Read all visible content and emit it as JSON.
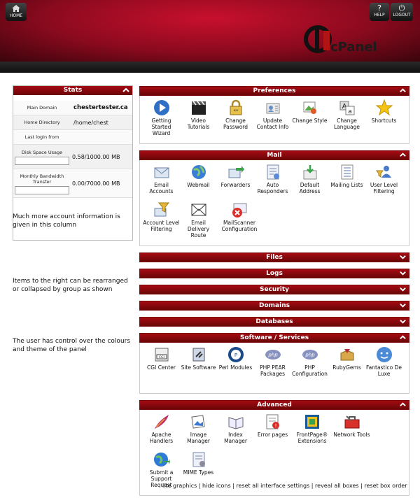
{
  "header": {
    "home_label": "HOME",
    "help_label": "HELP",
    "logout_label": "LOGOUT",
    "logo_text": "cPanel",
    "breadcrumb": ""
  },
  "stats": {
    "title": "Stats",
    "rows": [
      {
        "label": "Main Domain",
        "value": "chestertester.ca"
      },
      {
        "label": "Home Directory",
        "value": "/home/chest"
      },
      {
        "label": "Last login from",
        "value": ""
      },
      {
        "label": "Disk Space Usage",
        "value": "0.58/1000.00 MB"
      },
      {
        "label": "Monthly Bandwidth Transfer",
        "value": "0.00/7000.00 MB"
      }
    ]
  },
  "notes": [
    "Much more account information is given in this column",
    "Items to the right can be rearranged or collapsed by group as shown",
    "The user has control over the colours and theme of the panel"
  ],
  "groups": {
    "preferences": {
      "title": "Preferences",
      "items": [
        "Getting Started Wizard",
        "Video Tutorials",
        "Change Password",
        "Update Contact Info",
        "Change Style",
        "Change Language",
        "Shortcuts"
      ]
    },
    "mail": {
      "title": "Mail",
      "items": [
        "Email Accounts",
        "Webmail",
        "Forwarders",
        "Auto Responders",
        "Default Address",
        "Mailing Lists",
        "User Level Filtering",
        "Account Level Filtering",
        "Email Delivery Route",
        "MailScanner Configuration"
      ]
    },
    "collapsed": [
      "Files",
      "Logs",
      "Security",
      "Domains",
      "Databases"
    ],
    "software": {
      "title": "Software / Services",
      "items": [
        "CGI Center",
        "Site Software",
        "Perl Modules",
        "PHP PEAR Packages",
        "PHP Configuration",
        "RubyGems",
        "Fantastico De Luxe"
      ]
    },
    "advanced": {
      "title": "Advanced",
      "items": [
        "Apache Handlers",
        "Image Manager",
        "Index Manager",
        "Error pages",
        "FrontPage® Extensions",
        "Network Tools",
        "Submit a Support Request",
        "MIME Types"
      ]
    }
  },
  "footer": {
    "links": [
      "lite graphics",
      "hide icons",
      "reset all interface settings",
      "reveal all boxes",
      "reset box order"
    ],
    "separator": " | "
  },
  "colors": {
    "header_red": "#8b0a1e",
    "group_header": "#a40b12",
    "subbar": "#1a1a1a"
  }
}
